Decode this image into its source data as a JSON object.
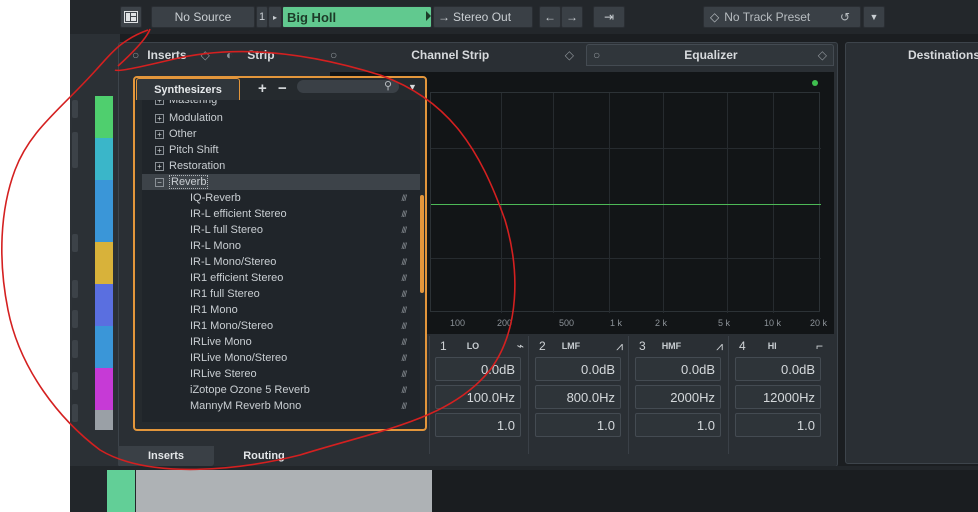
{
  "toolbar": {
    "source": "No Source",
    "input_number": "1",
    "track_name": "Big Holl",
    "output": "Stereo Out",
    "preset": "No Track Preset"
  },
  "panels": {
    "inserts_tab": "Inserts",
    "strip_tab": "Strip",
    "channel_strip": "Channel Strip",
    "equalizer": "Equalizer",
    "destinations": "Destinations"
  },
  "popup": {
    "tab": "Synthesizers",
    "plus": "+",
    "minus": "−",
    "items": [
      {
        "label": "Mastering",
        "kind": "folder",
        "expanded": false
      },
      {
        "label": "Modulation",
        "kind": "folder",
        "expanded": false
      },
      {
        "label": "Other",
        "kind": "folder",
        "expanded": false
      },
      {
        "label": "Pitch Shift",
        "kind": "folder",
        "expanded": false
      },
      {
        "label": "Restoration",
        "kind": "folder",
        "expanded": false
      },
      {
        "label": "Reverb",
        "kind": "folder",
        "expanded": true,
        "selected": true
      },
      {
        "label": "IQ-Reverb",
        "kind": "plugin"
      },
      {
        "label": "IR-L efficient Stereo",
        "kind": "plugin"
      },
      {
        "label": "IR-L full Stereo",
        "kind": "plugin"
      },
      {
        "label": "IR-L Mono",
        "kind": "plugin"
      },
      {
        "label": "IR-L Mono/Stereo",
        "kind": "plugin"
      },
      {
        "label": "IR1 efficient Stereo",
        "kind": "plugin"
      },
      {
        "label": "IR1 full Stereo",
        "kind": "plugin"
      },
      {
        "label": "IR1 Mono",
        "kind": "plugin"
      },
      {
        "label": "IR1 Mono/Stereo",
        "kind": "plugin"
      },
      {
        "label": "IRLive Mono",
        "kind": "plugin"
      },
      {
        "label": "IRLive Mono/Stereo",
        "kind": "plugin"
      },
      {
        "label": "IRLive Stereo",
        "kind": "plugin"
      },
      {
        "label": "iZotope Ozone 5 Reverb",
        "kind": "plugin"
      },
      {
        "label": "MannyM Reverb Mono",
        "kind": "plugin"
      }
    ],
    "bottom_tabs": [
      "Inserts",
      "Routing"
    ]
  },
  "equalizer": {
    "freq_labels": [
      "100",
      "200",
      "500",
      "1 k",
      "2 k",
      "5 k",
      "10 k",
      "20 k"
    ],
    "bands": [
      {
        "num": "1",
        "type": "LO",
        "gain": "0.0dB",
        "freq": "100.0Hz",
        "q": "1.0"
      },
      {
        "num": "2",
        "type": "LMF",
        "gain": "0.0dB",
        "freq": "800.0Hz",
        "q": "1.0"
      },
      {
        "num": "3",
        "type": "HMF",
        "gain": "0.0dB",
        "freq": "2000Hz",
        "q": "1.0"
      },
      {
        "num": "4",
        "type": "HI",
        "gain": "0.0dB",
        "freq": "12000Hz",
        "q": "1.0"
      }
    ]
  },
  "colors": {
    "accent_orange": "#e3963b",
    "track_green": "#61c98f",
    "annotation_red": "#d42020",
    "eq_curve": "#4db957"
  },
  "icons": {
    "layout": "window-layout-icon",
    "routing": "routing-icon",
    "search": "search-icon",
    "reload": "reload-icon",
    "menu": "chevron-down-icon"
  }
}
